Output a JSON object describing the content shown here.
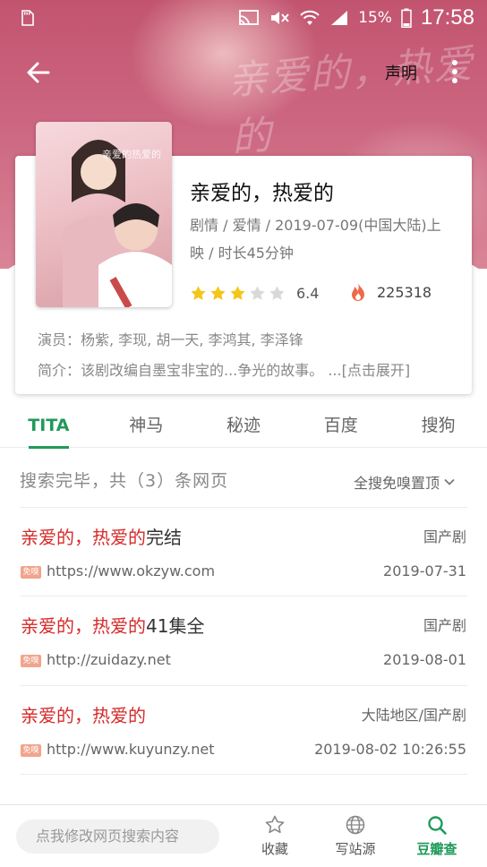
{
  "status_bar": {
    "battery": "15%",
    "time": "17:58"
  },
  "toolbar": {
    "statement": "声明"
  },
  "show": {
    "title": "亲爱的，热爱的",
    "meta": "剧情 / 爱情 / 2019-07-09(中国大陆)上映 / 时长45分钟",
    "rating": 6.4,
    "rating_text": "6.4",
    "stars_filled": 3,
    "stars_total": 5,
    "heat": "225318",
    "cast": "演员：杨紫, 李现, 胡一天, 李鸿其, 李泽锋",
    "intro": "简介：该剧改编自墨宝非宝的...争光的故事。 ...[点击展开]",
    "poster_text": "亲爱的热爱的"
  },
  "tabs": [
    {
      "label": "TITA",
      "active": true
    },
    {
      "label": "神马",
      "active": false
    },
    {
      "label": "秘迹",
      "active": false
    },
    {
      "label": "百度",
      "active": false
    },
    {
      "label": "搜狗",
      "active": false
    }
  ],
  "results_summary": "搜索完毕，共（3）条网页",
  "filter_label": "全搜免嗅置顶",
  "badge_label": "免嗅",
  "results": [
    {
      "title_hl": "亲爱的，热爱的",
      "title_rest": "完结",
      "category": "国产剧",
      "url": "https://www.okzyw.com",
      "date": "2019-07-31"
    },
    {
      "title_hl": "亲爱的，热爱的",
      "title_rest": "41集全",
      "category": "国产剧",
      "url": "http://zuidazy.net",
      "date": "2019-08-01"
    },
    {
      "title_hl": "亲爱的，热爱的",
      "title_rest": "",
      "category": "大陆地区/国产剧",
      "url": "http://www.kuyunzy.net",
      "date": "2019-08-02 10:26:55"
    }
  ],
  "bottom_bar": {
    "search_placeholder": "点我修改网页搜索内容",
    "favorite": "收藏",
    "write_source": "写站源",
    "douban": "豆瓣查"
  },
  "colors": {
    "accent": "#1f9a5a",
    "highlight": "#d62a2a",
    "hero": "#c2546f",
    "star": "#f5c518"
  }
}
